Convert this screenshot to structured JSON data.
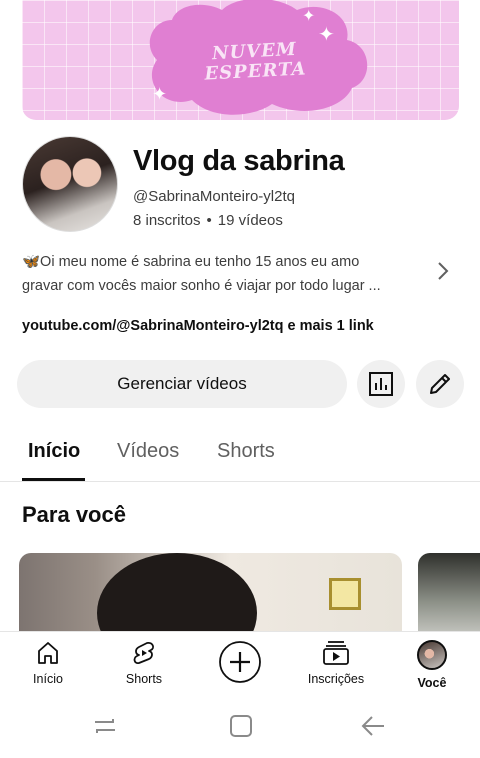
{
  "banner": {
    "text_line1": "NUVEM",
    "text_line2": "ESPERTA",
    "background_color": "#f3c6ec",
    "cloud_color": "#e07fd2"
  },
  "channel": {
    "title": "Vlog da sabrina",
    "handle": "@SabrinaMonteiro-yl2tq",
    "subscribers": "8 inscritos",
    "separator": "•",
    "videos": "19 vídeos",
    "description_line1": "🦋Oi meu nome é sabrina eu tenho 15 anos eu amo",
    "description_line2": "gravar com vocês maior sonho é viajar por todo lugar ...",
    "links": "youtube.com/@SabrinaMonteiro-yl2tq e mais 1 link"
  },
  "actions": {
    "manage_videos": "Gerenciar vídeos",
    "analytics_icon": "bar-chart-icon",
    "edit_icon": "pencil-icon"
  },
  "tabs": [
    {
      "label": "Início",
      "active": true
    },
    {
      "label": "Vídeos",
      "active": false
    },
    {
      "label": "Shorts",
      "active": false
    }
  ],
  "section": {
    "title": "Para você"
  },
  "bottom_nav": [
    {
      "label": "Início",
      "icon": "home-icon"
    },
    {
      "label": "Shorts",
      "icon": "shorts-icon"
    },
    {
      "label": "",
      "icon": "create-plus-icon"
    },
    {
      "label": "Inscrições",
      "icon": "subscriptions-icon"
    },
    {
      "label": "Você",
      "icon": "profile-avatar-icon"
    }
  ],
  "system_nav": {
    "recents_icon": "recents-icon",
    "home_icon": "home-square-icon",
    "back_icon": "back-arrow-icon"
  }
}
